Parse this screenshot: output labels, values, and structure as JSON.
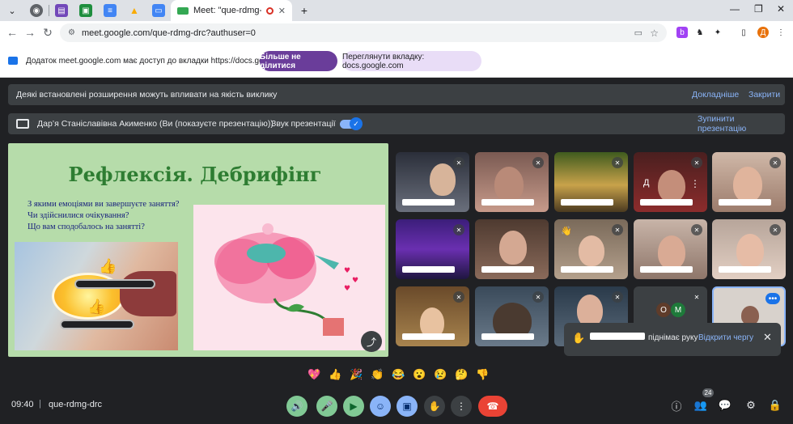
{
  "browser": {
    "active_tab_title": "Meet: \"que-rdmg-drc\"",
    "url": "meet.google.com/que-rdmg-drc?authuser=0",
    "profile_initial": "Д"
  },
  "sharebar": {
    "message": "Додаток meet.google.com має доступ до вкладки https://docs.google.com",
    "stop_sharing": "Більше не ділитися",
    "view_tab": "Переглянути вкладку: docs.google.com"
  },
  "extensions_banner": {
    "text": "Деякі встановлені розширення можуть впливати на якість виклику",
    "more": "Докладніше",
    "close": "Закрити"
  },
  "presenting_banner": {
    "presenter": "Дар’я Станіславівна Акименко (Ви (показуєте презентацію))",
    "audio_label": "Звук презентації",
    "stop": "Зупинити презентацію"
  },
  "slide": {
    "title": "Рефлексія. Дебрифінг",
    "questions": [
      "З якими емоціями ви завершуєте заняття?",
      "Чи здійснилися очікування?",
      "Що вам сподобалось на занятті?"
    ]
  },
  "tiles": {
    "initials_left": "О",
    "initials_right": "М",
    "d_label": "Д"
  },
  "notification": {
    "suffix": "піднімає руку",
    "action": "Відкрити чергу"
  },
  "reactions": [
    "💖",
    "👍",
    "🎉",
    "👏",
    "😂",
    "😮",
    "😢",
    "🤔",
    "👎"
  ],
  "bottom": {
    "time": "09:40",
    "separator": "|",
    "meeting_code": "que-rdmg-drc",
    "participants_count": "24"
  },
  "colors": {
    "accent_blue": "#8ab4f8",
    "end_call_red": "#ea4335",
    "active_green": "#81c995",
    "slide_green": "#b6dcaa",
    "title_green": "#2e7d32",
    "stop_button": "#6a3d9a"
  }
}
